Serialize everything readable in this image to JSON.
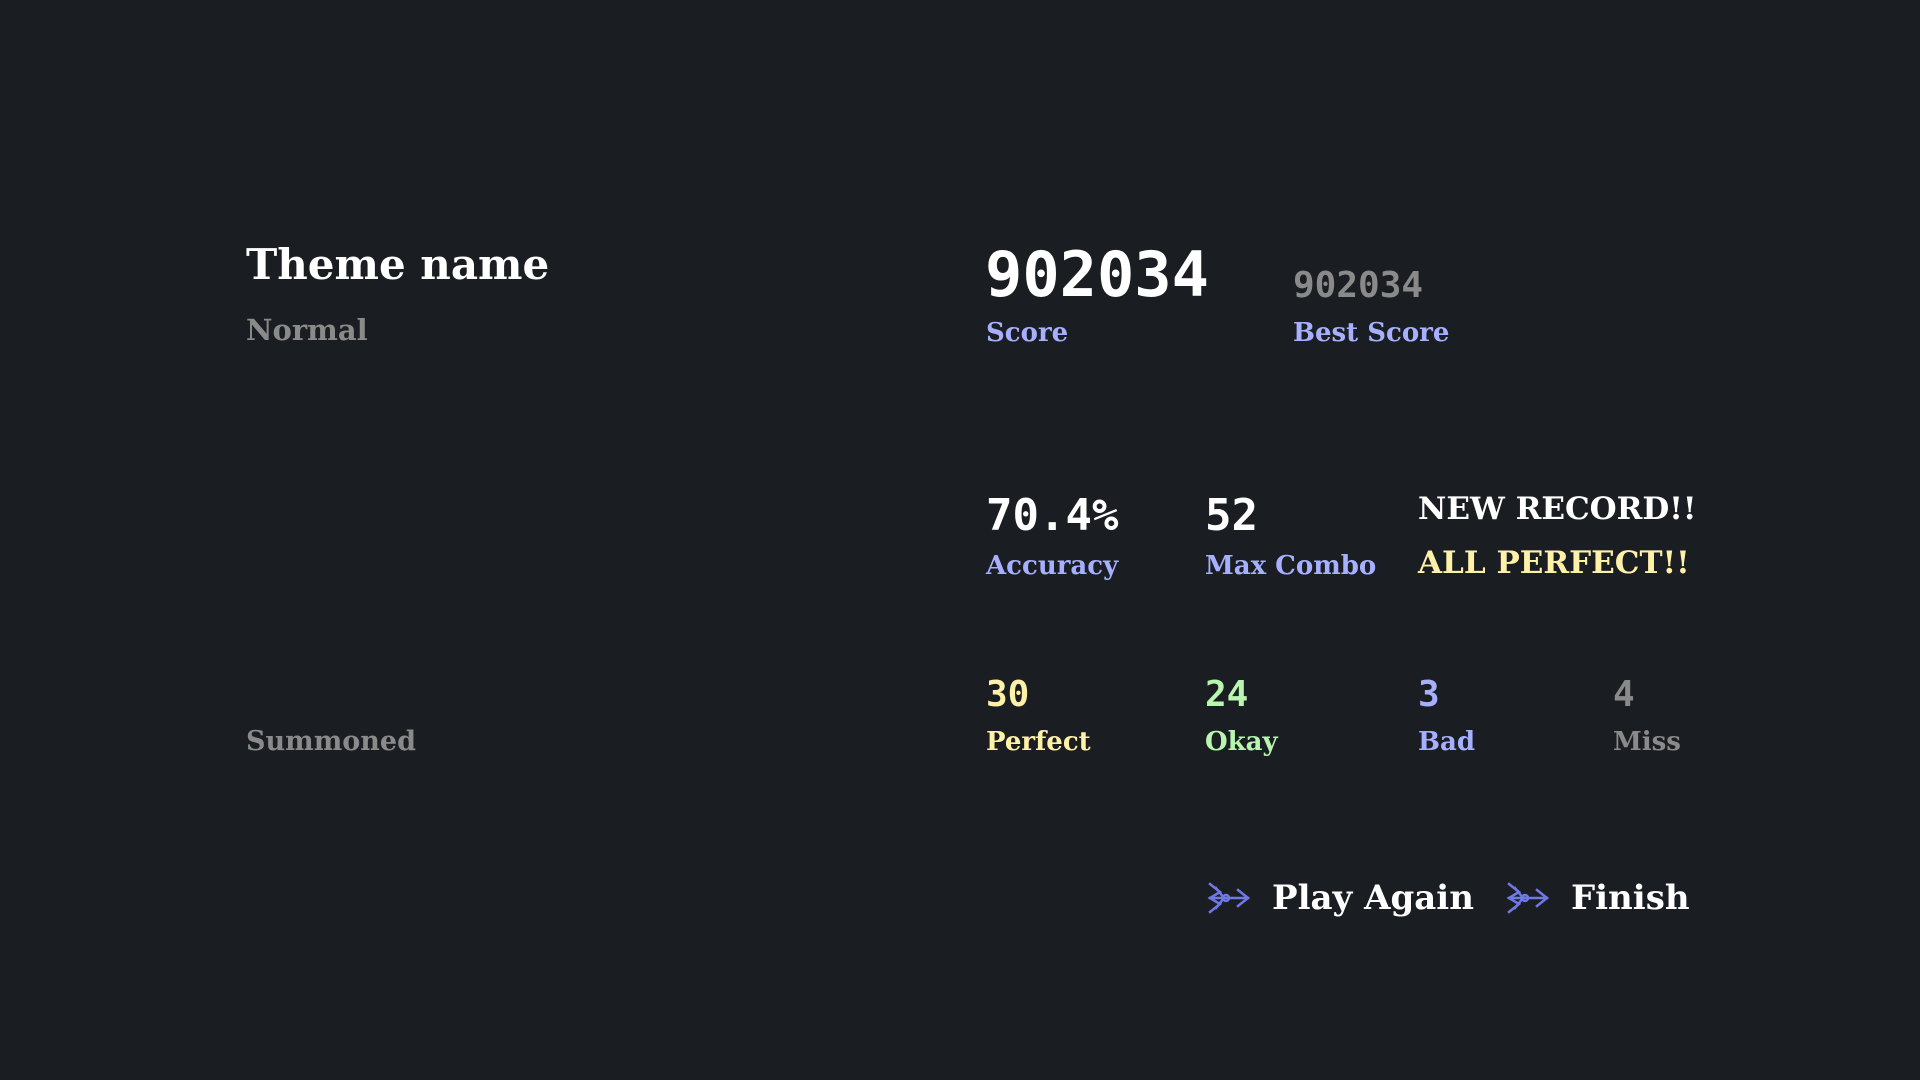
{
  "theme": {
    "name": "Theme name",
    "difficulty": "Normal",
    "summoned_label": "Summoned"
  },
  "score": {
    "value": "902034",
    "label": "Score"
  },
  "best_score": {
    "value": "902034",
    "label": "Best Score"
  },
  "accuracy": {
    "value": "70.4%",
    "label": "Accuracy"
  },
  "max_combo": {
    "value": "52",
    "label": "Max Combo"
  },
  "badges": {
    "new_record": "NEW RECORD!!",
    "all_perfect": "ALL PERFECT!!"
  },
  "judgements": {
    "perfect": {
      "value": "30",
      "label": "Perfect"
    },
    "okay": {
      "value": "24",
      "label": "Okay"
    },
    "bad": {
      "value": "3",
      "label": "Bad"
    },
    "miss": {
      "value": "4",
      "label": "Miss"
    }
  },
  "buttons": {
    "play_again": {
      "label": "Play Again",
      "icon": "ornate-arrow-icon"
    },
    "finish": {
      "label": "Finish",
      "icon": "ornate-arrow-icon"
    }
  },
  "colors": {
    "background": "#1a1d21",
    "label_accent": "#a6b0ff",
    "perfect": "#fff1a8",
    "okay": "#b9f5b0",
    "bad": "#a6b0ff",
    "muted": "#8a8a8a",
    "icon": "#6f79e6"
  }
}
